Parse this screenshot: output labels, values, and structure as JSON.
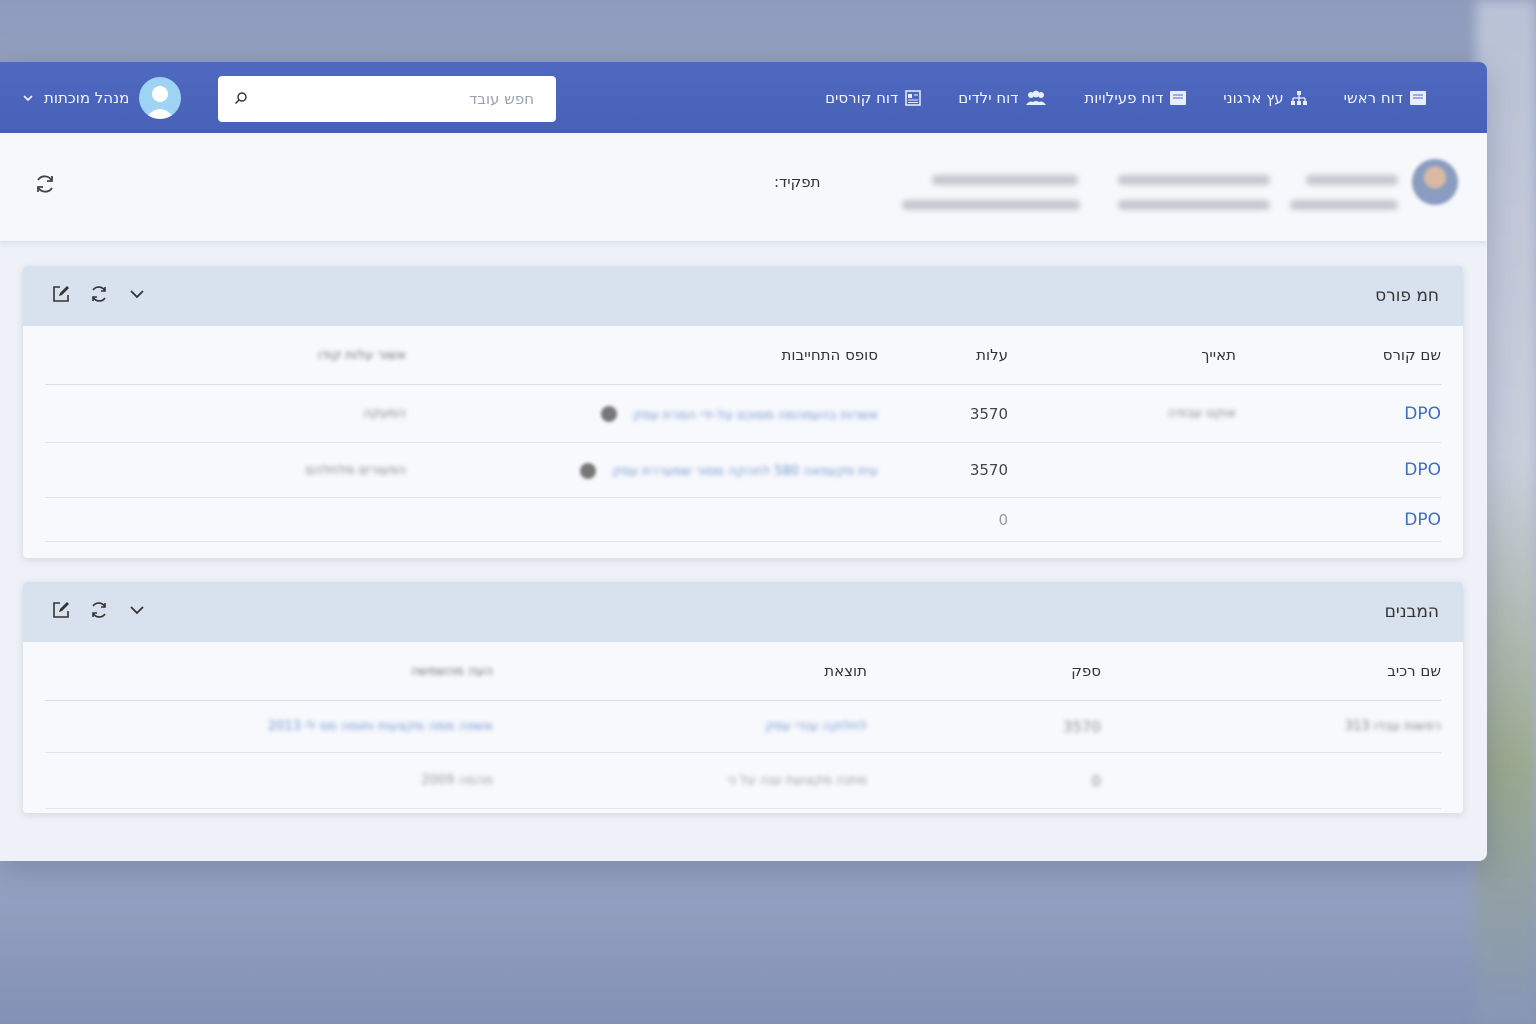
{
  "nav": {
    "items": [
      {
        "label": "דוח ראשי",
        "icon": "book-icon"
      },
      {
        "label": "עץ ארגוני",
        "icon": "org-chart-icon"
      },
      {
        "label": "דוח פעילויות",
        "icon": "book-icon"
      },
      {
        "label": "דוח ילדים",
        "icon": "users-icon"
      },
      {
        "label": "דוח קורסים",
        "icon": "newspaper-icon"
      }
    ],
    "search_placeholder": "חפש עובד",
    "user_name": "מנהל מוכתות"
  },
  "employee": {
    "role_label": "תפקיד:"
  },
  "panels": {
    "courses": {
      "title": "חמ פורס",
      "columns": [
        "שם קורס",
        "תאייך",
        "עלות",
        "סופס התחייבות",
        "אשור עלות קודו"
      ],
      "rows": [
        {
          "name": "DPO",
          "date": "אוקט עבודה",
          "cost": "3570",
          "commit": "אשרות בהעמהמה מסוכם על-ידי המרת עסק",
          "approval": "המעקה"
        },
        {
          "name": "DPO",
          "date": "",
          "cost": "3570",
          "commit": "עית סקעפאה 580 לחהקה מסור שמעררת עסק",
          "approval": "הפעורים מלחלהם"
        },
        {
          "name": "DPO",
          "date": "",
          "cost": "0",
          "commit": "",
          "approval": ""
        }
      ]
    },
    "components": {
      "title": "המבנים",
      "columns": [
        "שם רכיב",
        "ספק",
        "תוצאת",
        "העה מהשמשה"
      ],
      "rows": [
        {
          "name": "רפשות עבדו 313",
          "supplier": "3570",
          "result": "לחלוקה ענדי עסק",
          "notes": "אשפה ממה מקצעות ותומה מס לי 2013"
        },
        {
          "name": "",
          "supplier": "0",
          "result": "מתנה מקצועת ענה על ני",
          "notes": "מהמה 2009"
        }
      ]
    }
  }
}
